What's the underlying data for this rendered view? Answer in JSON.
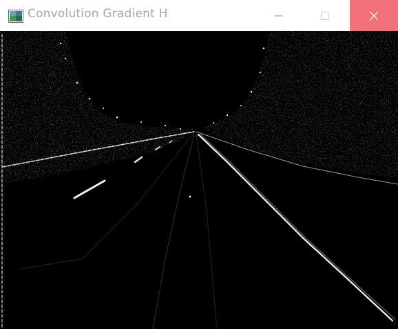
{
  "window": {
    "title": "Convolution Gradient H",
    "app_icon": "opencv-window-icon",
    "controls": [
      "minimize-icon",
      "maximize-icon",
      "close-icon"
    ],
    "accent_close": "#f1707a"
  },
  "image_view": {
    "content": "horizontal-gradient-edge-map-of-road",
    "background": "#000000",
    "edge_color": "#ffffff"
  }
}
